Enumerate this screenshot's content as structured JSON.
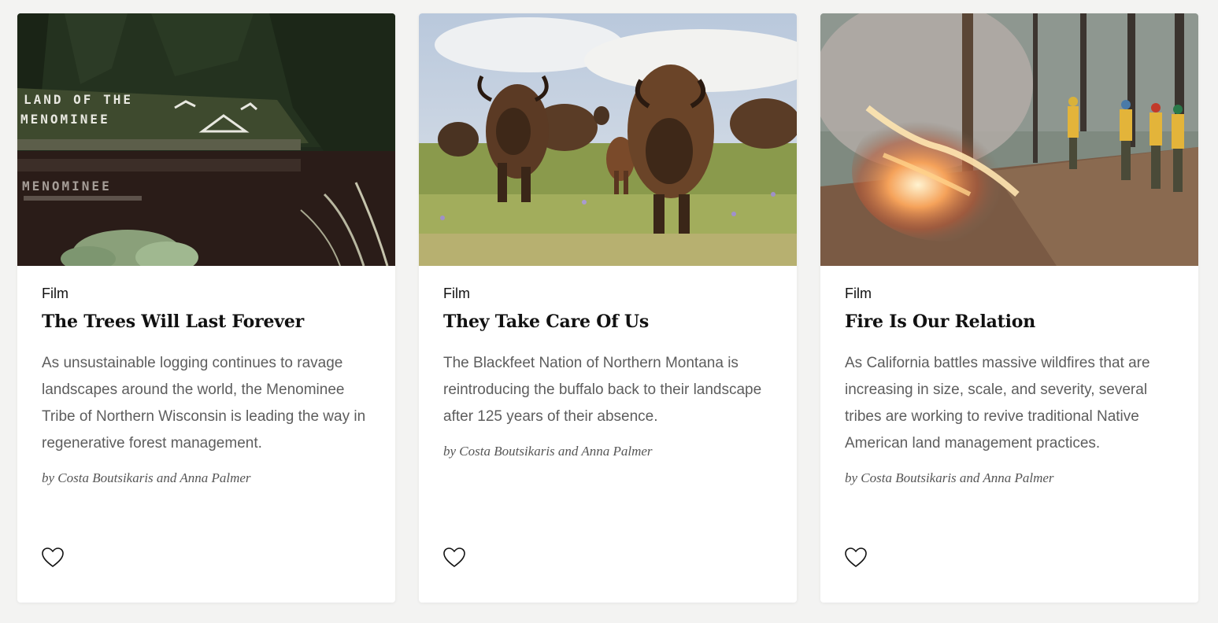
{
  "cards": [
    {
      "category": "Film",
      "title": "The Trees Will Last Forever",
      "description": "As unsustainable logging continues to ravage landscapes around the world, the Menominee Tribe of Northern Wisconsin is leading the way in regenerative forest management.",
      "byline": "by Costa Boutsikaris and Anna Palmer",
      "image_sign_line1": "LAND OF THE",
      "image_sign_line2": "MENOMINEE",
      "image_reflection": "MENOMINEE",
      "like_icon": "heart-outline-icon"
    },
    {
      "category": "Film",
      "title": "They Take Care Of Us",
      "description": "The Blackfeet Nation of Northern Montana is reintroducing the buffalo back to their landscape after 125 years of their absence.",
      "byline": "by Costa Boutsikaris and Anna Palmer",
      "like_icon": "heart-outline-icon"
    },
    {
      "category": "Film",
      "title": "Fire Is Our Relation",
      "description": "As California battles massive wildfires that are increasing in size, scale, and severity, several tribes are working to revive traditional Native American land management practices.",
      "byline": "by Costa Boutsikaris and Anna Palmer",
      "like_icon": "heart-outline-icon"
    }
  ],
  "colors": {
    "page_background": "#f3f3f2",
    "card_background": "#ffffff",
    "title_text": "#111111",
    "body_text": "#5d5d5d"
  }
}
